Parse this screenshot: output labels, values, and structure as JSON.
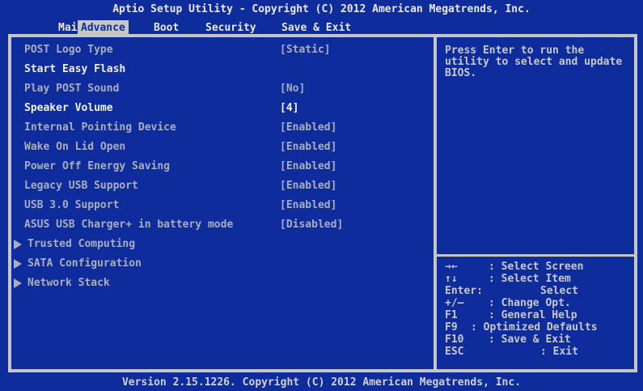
{
  "title": "Aptio Setup Utility - Copyright (C) 2012 American Megatrends, Inc.",
  "tabs": [
    {
      "label": "Main",
      "active": false
    },
    {
      "label": "Advance",
      "active": true
    },
    {
      "label": "Boot",
      "active": false
    },
    {
      "label": "Security",
      "active": false
    },
    {
      "label": "Save & Exit",
      "active": false
    }
  ],
  "items": [
    {
      "label": "POST Logo Type",
      "value": "[Static]"
    },
    {
      "label": "Start Easy Flash",
      "value": ""
    },
    {
      "label": "Play POST Sound",
      "value": "[No]"
    },
    {
      "label": "Speaker Volume",
      "value": "[4]"
    },
    {
      "label": "Internal Pointing Device",
      "value": "[Enabled]"
    },
    {
      "label": "Wake On Lid Open",
      "value": "[Enabled]"
    },
    {
      "label": "Power Off Energy Saving",
      "value": "[Enabled]"
    },
    {
      "label": "Legacy USB Support",
      "value": "[Enabled]"
    },
    {
      "label": "USB 3.0 Support",
      "value": "[Enabled]"
    },
    {
      "label": "ASUS USB Charger+ in battery mode",
      "value": "[Disabled]"
    }
  ],
  "submenus": [
    {
      "label": "Trusted Computing"
    },
    {
      "label": "SATA Configuration"
    },
    {
      "label": "Network Stack"
    }
  ],
  "help_text": "Press Enter to run the utility to select and update BIOS.",
  "keys": [
    {
      "key": "→←",
      "action": ": Select Screen"
    },
    {
      "key": "↑↓",
      "action": ": Select Item"
    },
    {
      "key": "Enter:",
      "action": "Select"
    },
    {
      "key": "+/—",
      "action": ": Change Opt."
    },
    {
      "key": "F1",
      "action": ": General Help"
    },
    {
      "key": "F9",
      "action": ": Optimized Defaults"
    },
    {
      "key": "F10",
      "action": ": Save & Exit"
    },
    {
      "key": "ESC",
      "action": ": Exit"
    }
  ],
  "footer": "Version 2.15.1226. Copyright (C) 2012 American Megatrends, Inc.",
  "colors": {
    "background": "#0f2c9c",
    "frame": "#c6c6c6",
    "text": "#a8aebd",
    "highlight": "#f2f2f2"
  }
}
